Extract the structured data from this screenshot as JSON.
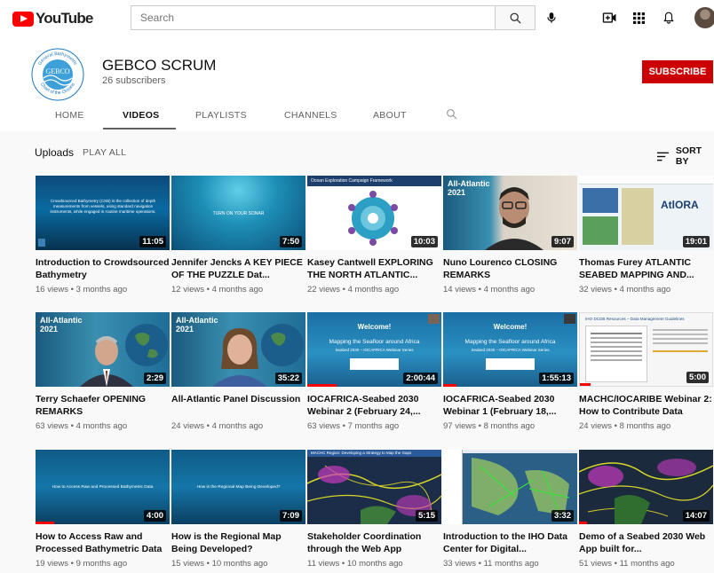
{
  "topbar": {
    "logo_text": "YouTube",
    "search_placeholder": "Search",
    "icons": [
      "search-icon",
      "mic-icon",
      "create-video-icon",
      "apps-grid-icon",
      "bell-icon",
      "avatar"
    ]
  },
  "channel": {
    "name": "GEBCO SCRUM",
    "subscribers": "26 subscribers",
    "subscribe_label": "SUBSCRIBE",
    "logo_ring_text_top": "General Bathymetric",
    "logo_ring_text_bottom": "Chart of the Oceans",
    "logo_center": "GEBCO"
  },
  "tabs": [
    {
      "label": "HOME",
      "active": false
    },
    {
      "label": "VIDEOS",
      "active": true
    },
    {
      "label": "PLAYLISTS",
      "active": false
    },
    {
      "label": "CHANNELS",
      "active": false
    },
    {
      "label": "ABOUT",
      "active": false
    }
  ],
  "section": {
    "title": "Uploads",
    "play_all": "PLAY ALL",
    "sort_by": "SORT BY"
  },
  "videos": [
    {
      "title": "Introduction to Crowdsourced Bathymetry",
      "meta": "16 views • 3 months ago",
      "duration": "11:05"
    },
    {
      "title": "Jennifer Jencks A KEY PIECE OF THE PUZZLE Dat...",
      "meta": "12 views • 4 months ago",
      "duration": "7:50"
    },
    {
      "title": "Kasey Cantwell EXPLORING THE NORTH ATLANTIC...",
      "meta": "22 views • 4 months ago",
      "duration": "10:03"
    },
    {
      "title": "Nuno Lourenco CLOSING REMARKS",
      "meta": "14 views • 4 months ago",
      "duration": "9:07"
    },
    {
      "title": "Thomas Furey ATLANTIC SEABED MAPPING AND...",
      "meta": "32 views • 4 months ago",
      "duration": "19:01"
    },
    {
      "title": "Terry Schaefer OPENING REMARKS",
      "meta": "63 views • 4 months ago",
      "duration": "2:29"
    },
    {
      "title": "All-Atlantic Panel Discussion",
      "meta": "24 views • 4 months ago",
      "duration": "35:22"
    },
    {
      "title": "IOCAFRICA-Seabed 2030 Webinar 2 (February 24,...",
      "meta": "63 views • 7 months ago",
      "duration": "2:00:44"
    },
    {
      "title": "IOCAFRICA-Seabed 2030 Webinar 1 (February 18,...",
      "meta": "97 views • 8 months ago",
      "duration": "1:55:13"
    },
    {
      "title": "MACHC/IOCARIBE Webinar 2: How to Contribute Data",
      "meta": "24 views • 8 months ago",
      "duration": "5:00"
    },
    {
      "title": "How to Access Raw and Processed Bathymetric Data",
      "meta": "19 views • 9 months ago",
      "duration": "4:00"
    },
    {
      "title": "How is the Regional Map Being Developed?",
      "meta": "15 views • 10 months ago",
      "duration": "7:09"
    },
    {
      "title": "Stakeholder Coordination through the Web App",
      "meta": "11 views • 10 months ago",
      "duration": "5:15"
    },
    {
      "title": "Introduction to the IHO Data Center for Digital...",
      "meta": "33 views • 11 months ago",
      "duration": "3:32"
    },
    {
      "title": "Demo of a Seabed 2030 Web App built for...",
      "meta": "51 views • 11 months ago",
      "duration": "14:07"
    }
  ],
  "thumb_text": {
    "t0": "Crowdsourced Bathymetry (CSB) is the collection of depth measurements from vessels, using standard navigation instruments, while engaged in routine maritime operations.",
    "t1": "TURN ON YOUR SONAR",
    "t2": "Ocean Exploration Campaign Framework",
    "t3_a": "All-Atlantic",
    "t3_b": "2021",
    "t4": "AtlORA",
    "t5_a": "All-Atlantic",
    "t5_b": "2021",
    "t6_a": "All-Atlantic",
    "t6_b": "2021",
    "t7_a": "Welcome!",
    "t7_b": "Mapping the Seafloor around Africa",
    "t7_c": "Seabed 2030 – IOCAFRICA Webinar Series",
    "t8_a": "Welcome!",
    "t8_b": "Mapping the Seafloor around Africa",
    "t8_c": "Seabed 2030 – IOCAFRICA Webinar Series",
    "t9": "IHO DCDB Resources – Data Management Guidelines",
    "t10": "How to Access Raw and Processed Bathymetric Data",
    "t11": "How is the Regional Map Being Developed?",
    "t12": "MACHC Region: Developing a Strategy to Map the Gaps"
  }
}
